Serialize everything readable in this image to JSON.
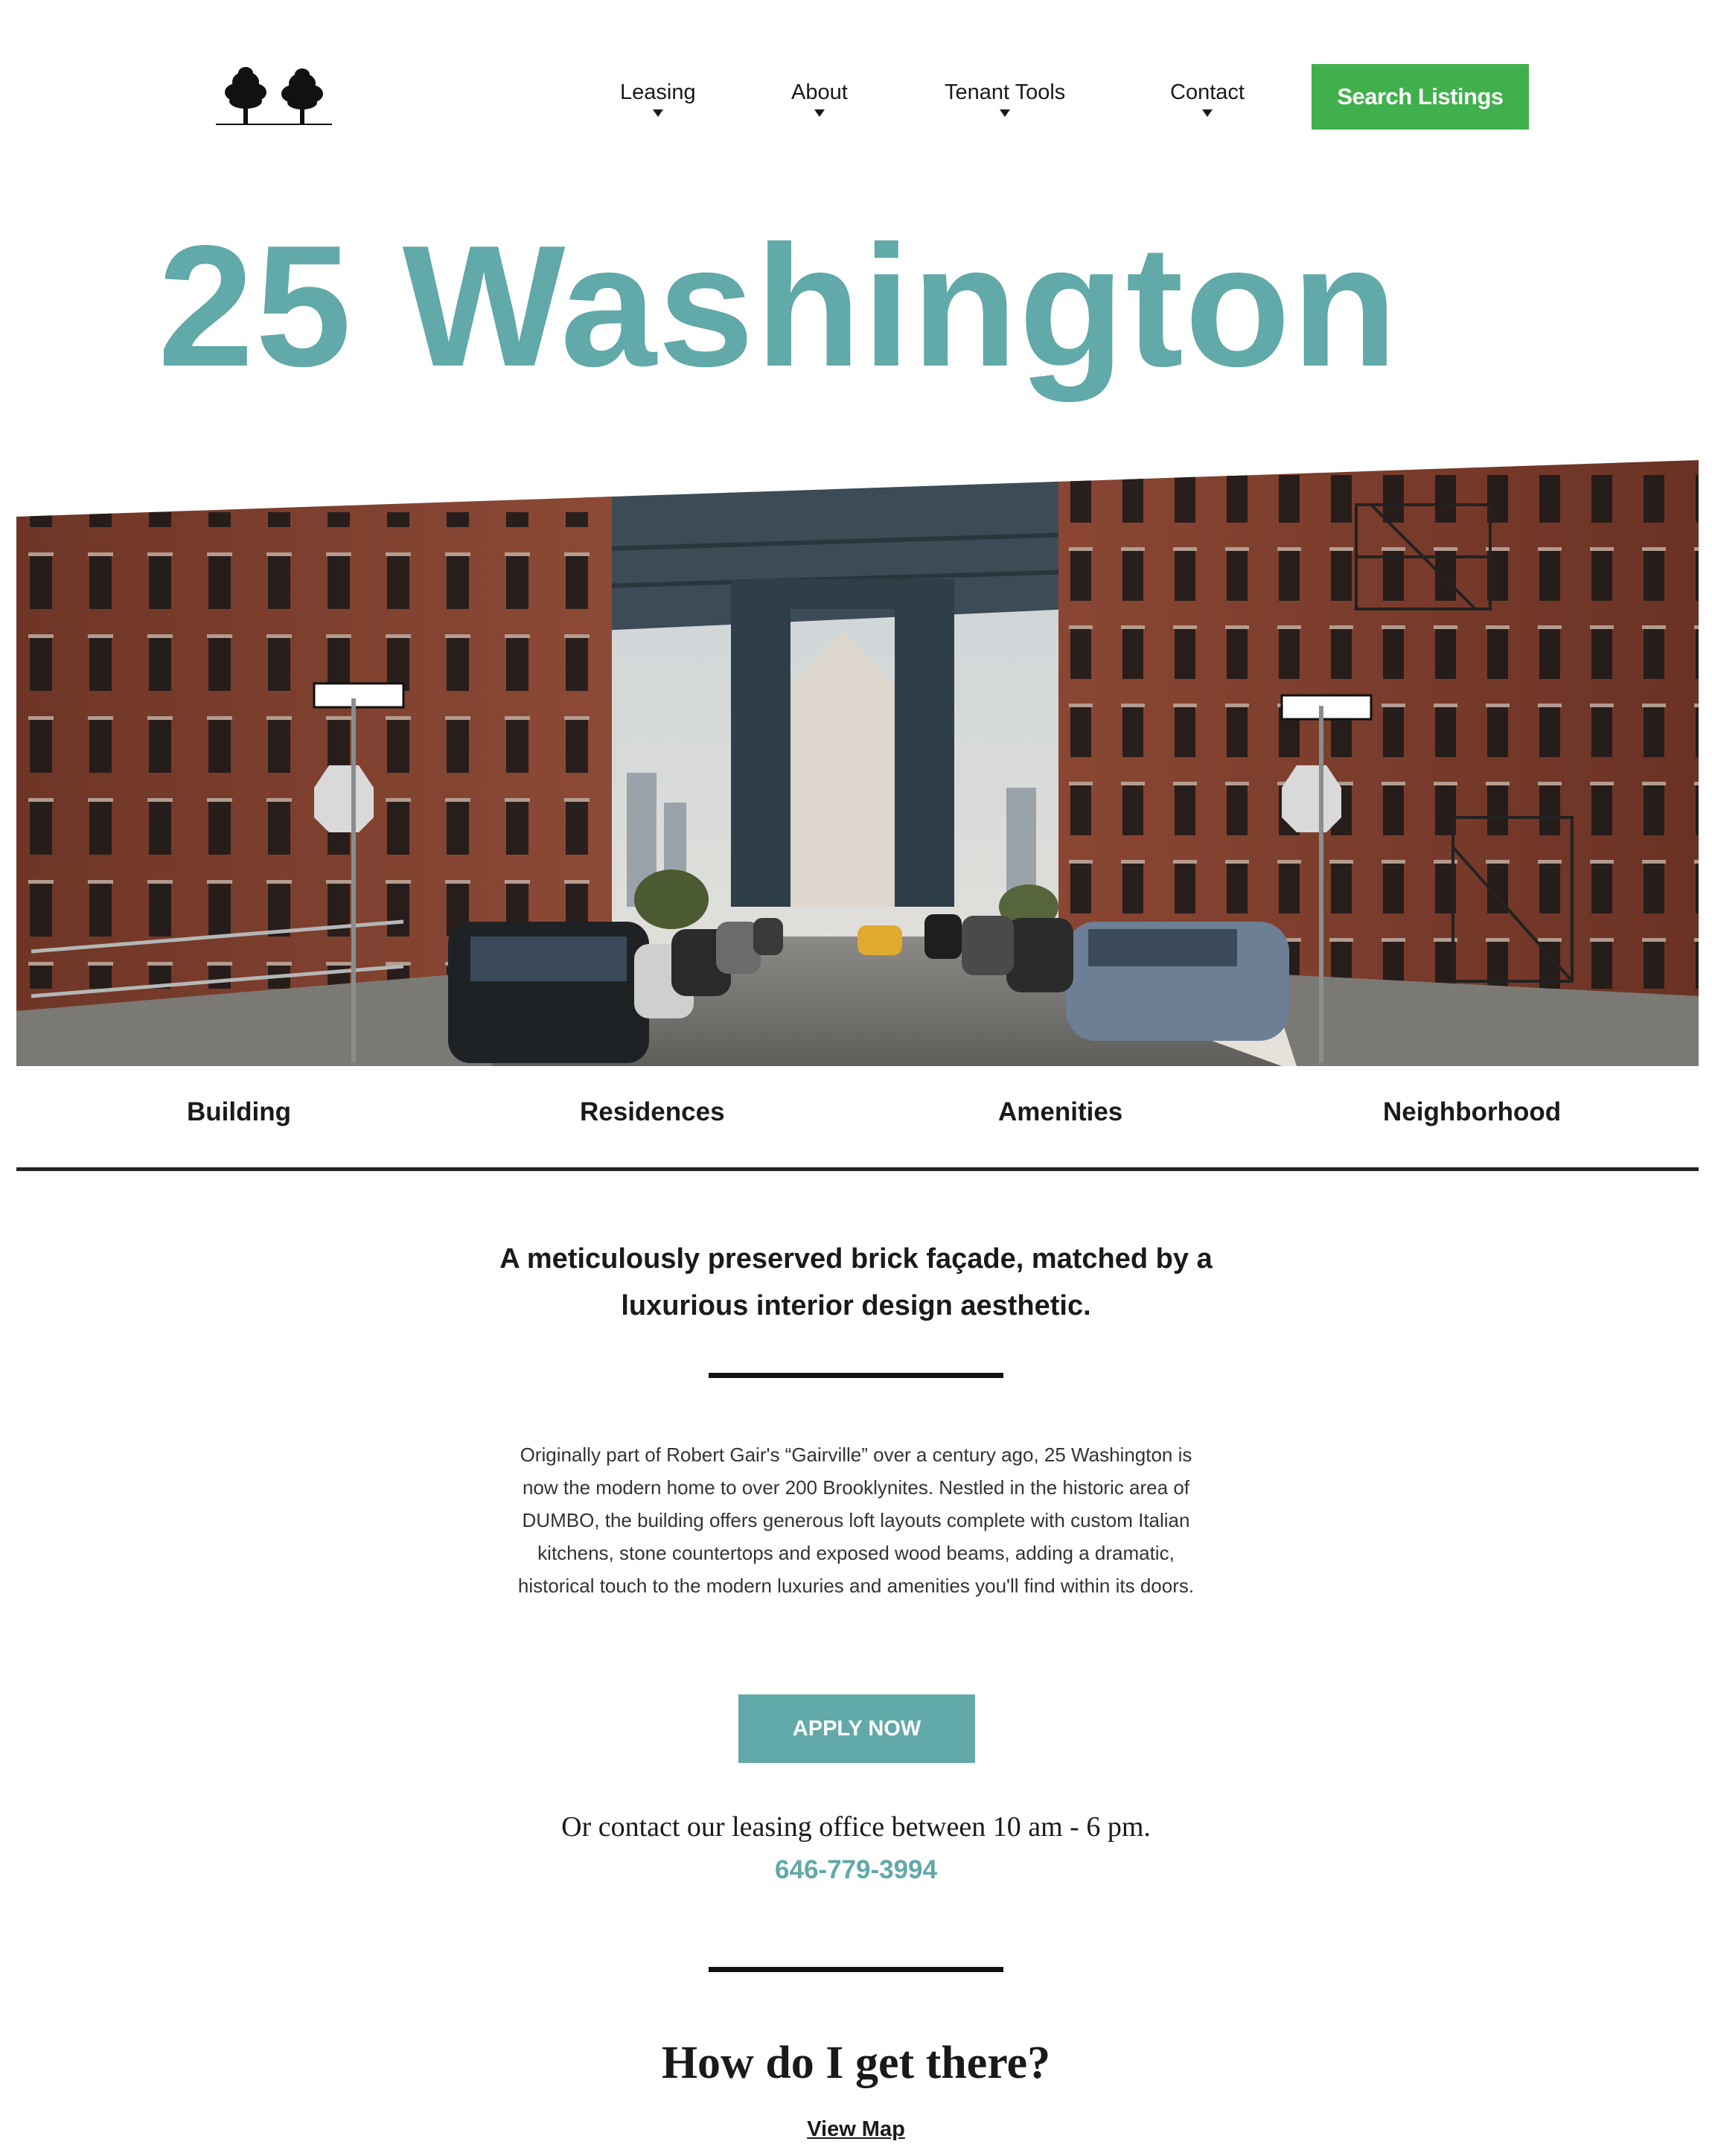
{
  "header": {
    "logo_name": "two-trees-logo",
    "nav": [
      {
        "label": "Leasing"
      },
      {
        "label": "About"
      },
      {
        "label": "Tenant Tools"
      },
      {
        "label": "Contact"
      }
    ],
    "search_label": "Search Listings"
  },
  "title": "25 Washington",
  "hero": {
    "description_icon": "street-bridge-photo"
  },
  "subnav": [
    {
      "label": "Building"
    },
    {
      "label": "Residences"
    },
    {
      "label": "Amenities"
    },
    {
      "label": "Neighborhood"
    }
  ],
  "content": {
    "tagline": "A meticulously preserved brick façade, matched by a luxurious interior design aesthetic.",
    "description": "Originally part of Robert Gair's “Gairville” over a century ago, 25 Washington is now the modern home to over 200 Brooklynites. Nestled in the historic area of DUMBO, the building offers generous loft layouts complete with custom Italian kitchens, stone countertops and exposed wood beams, adding a dramatic, historical touch to the modern luxuries and amenities you'll find within its doors.",
    "apply_label": "APPLY NOW",
    "contact_text": "Or contact our leasing office between 10 am - 6 pm.",
    "phone": "646-779-3994",
    "directions_heading": "How do I get there?",
    "view_map_label": "View Map"
  },
  "colors": {
    "accent_teal": "#62a9a9",
    "search_green": "#3fb04b",
    "text_dark": "#1a1a1a"
  }
}
